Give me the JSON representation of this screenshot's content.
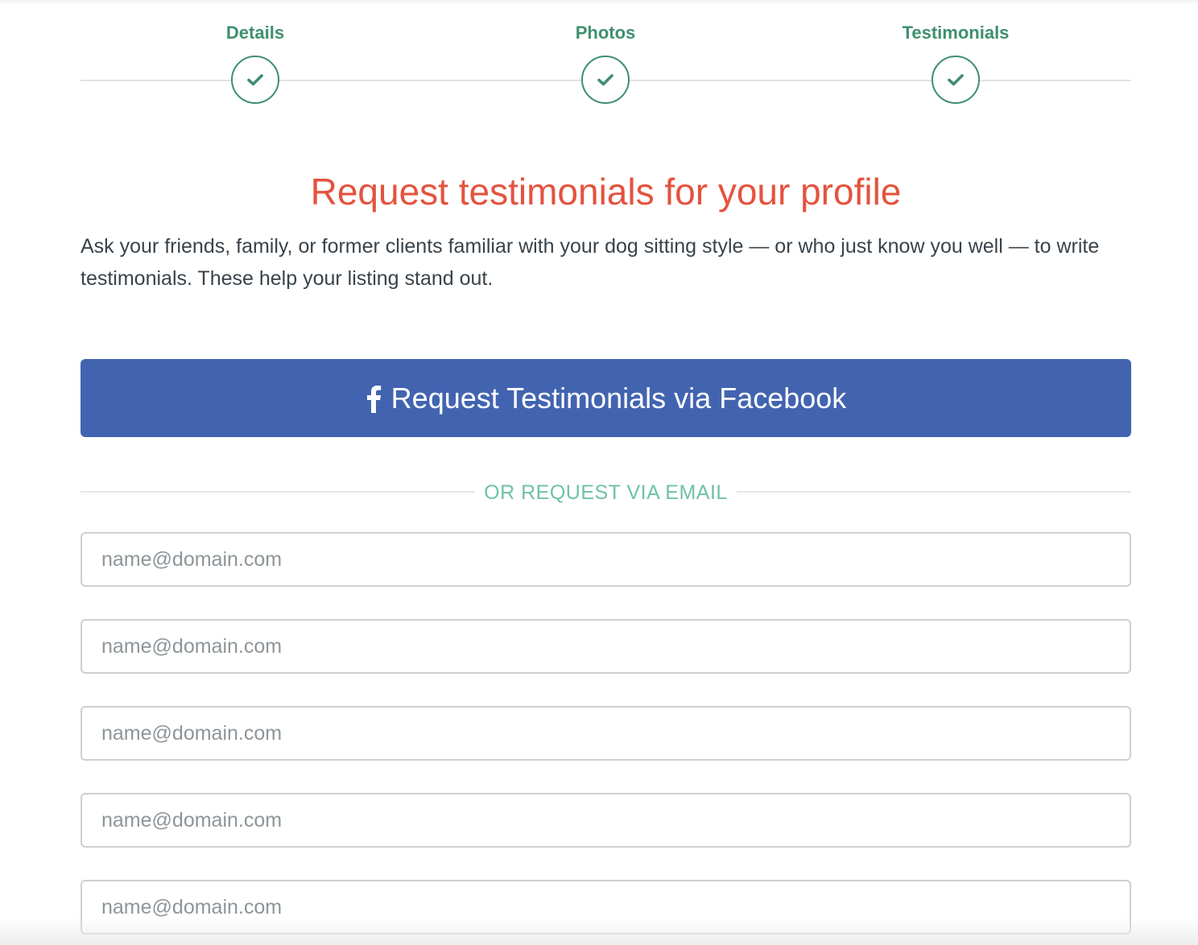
{
  "stepper": {
    "steps": [
      {
        "label": "Details",
        "icon": "check-icon",
        "status": "complete"
      },
      {
        "label": "Photos",
        "icon": "check-icon",
        "status": "complete"
      },
      {
        "label": "Testimonials",
        "icon": "check-icon",
        "status": "complete"
      }
    ]
  },
  "main": {
    "title": "Request testimonials for your profile",
    "intro": "Ask your friends, family, or former clients familiar with your dog sitting style — or who just know you well — to write testimonials. These help your listing stand out.",
    "facebook_button": {
      "label": "Request Testimonials via Facebook",
      "icon": "facebook-icon"
    },
    "divider_text": "OR REQUEST VIA EMAIL",
    "email_fields": [
      {
        "placeholder": "name@domain.com",
        "value": ""
      },
      {
        "placeholder": "name@domain.com",
        "value": ""
      },
      {
        "placeholder": "name@domain.com",
        "value": ""
      },
      {
        "placeholder": "name@domain.com",
        "value": ""
      },
      {
        "placeholder": "name@domain.com",
        "value": ""
      }
    ]
  },
  "colors": {
    "step_green": "#3f8f6e",
    "title_red": "#e4533f",
    "facebook_blue": "#4264b0",
    "divider_teal": "#6fc2a3",
    "body_text": "#39434b"
  }
}
